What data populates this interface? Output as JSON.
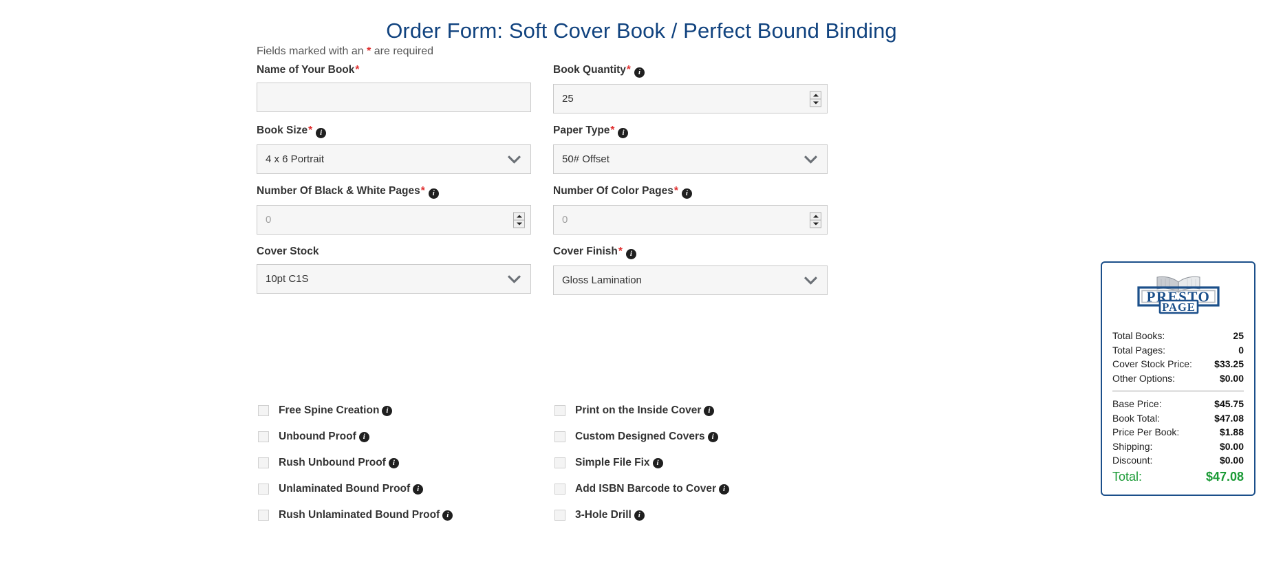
{
  "page": {
    "title": "Order Form: Soft Cover Book / Perfect Bound Binding",
    "required_note_prefix": "Fields marked with an",
    "required_note_star": "*",
    "required_note_suffix": "are required",
    "title_color": "#11437f",
    "required_star_color": "#e03030"
  },
  "form": {
    "rows": [
      {
        "left": {
          "label": "Name of Your Book",
          "required": true,
          "has_info": false,
          "control": "text",
          "value": "",
          "placeholder": ""
        },
        "right": {
          "label": "Book Quantity",
          "required": true,
          "has_info": true,
          "control": "number",
          "value": "25",
          "placeholder": ""
        }
      },
      {
        "left": {
          "label": "Book Size",
          "required": true,
          "has_info": true,
          "control": "select",
          "value": "4 x 6 Portrait"
        },
        "right": {
          "label": "Paper Type",
          "required": true,
          "has_info": true,
          "control": "select",
          "value": "50# Offset"
        }
      },
      {
        "left": {
          "label": "Number Of Black & White Pages",
          "required": true,
          "has_info": true,
          "control": "number",
          "value": "",
          "placeholder": "0"
        },
        "right": {
          "label": "Number Of Color Pages",
          "required": true,
          "has_info": true,
          "control": "number",
          "value": "",
          "placeholder": "0"
        }
      },
      {
        "left": {
          "label": "Cover Stock",
          "required": false,
          "has_info": false,
          "control": "select",
          "value": "10pt C1S"
        },
        "right": {
          "label": "Cover Finish",
          "required": true,
          "has_info": true,
          "control": "select",
          "value": "Gloss Lamination"
        }
      }
    ]
  },
  "options": {
    "rows": [
      {
        "left": {
          "label": "Free Spine Creation",
          "checked": false,
          "has_info": true
        },
        "right": {
          "label": "Print on the Inside Cover",
          "checked": false,
          "has_info": true
        }
      },
      {
        "left": {
          "label": "Unbound Proof",
          "checked": false,
          "has_info": true
        },
        "right": {
          "label": "Custom Designed Covers",
          "checked": false,
          "has_info": true
        }
      },
      {
        "left": {
          "label": "Rush Unbound Proof",
          "checked": false,
          "has_info": true
        },
        "right": {
          "label": "Simple File Fix",
          "checked": false,
          "has_info": true
        }
      },
      {
        "left": {
          "label": "Unlaminated Bound Proof",
          "checked": false,
          "has_info": true
        },
        "right": {
          "label": "Add ISBN Barcode to Cover",
          "checked": false,
          "has_info": true
        }
      },
      {
        "left": {
          "label": "Rush Unlaminated Bound Proof",
          "checked": false,
          "has_info": true
        },
        "right": {
          "label": "3-Hole Drill",
          "checked": false,
          "has_info": true
        }
      }
    ]
  },
  "summary": {
    "logo": {
      "top_word": "PRESTO",
      "bottom_word": "PAGE",
      "icon": "open-book-icon",
      "color": "#1b4f8a"
    },
    "lines": [
      {
        "label": "Total Books:",
        "value": "25"
      },
      {
        "label": "Total Pages:",
        "value": "0"
      },
      {
        "label": "Cover Stock Price:",
        "value": "$33.25"
      },
      {
        "label": "Other Options:",
        "value": "$0.00"
      }
    ],
    "lines2": [
      {
        "label": "Base Price:",
        "value": "$45.75"
      },
      {
        "label": "Book Total:",
        "value": "$47.08"
      },
      {
        "label": "Price Per Book:",
        "value": "$1.88"
      },
      {
        "label": "Shipping:",
        "value": "$0.00"
      },
      {
        "label": "Discount:",
        "value": "$0.00"
      }
    ],
    "total": {
      "label": "Total:",
      "value": "$47.08",
      "color": "#1a9a35"
    },
    "border_color": "#1b4f8a"
  }
}
